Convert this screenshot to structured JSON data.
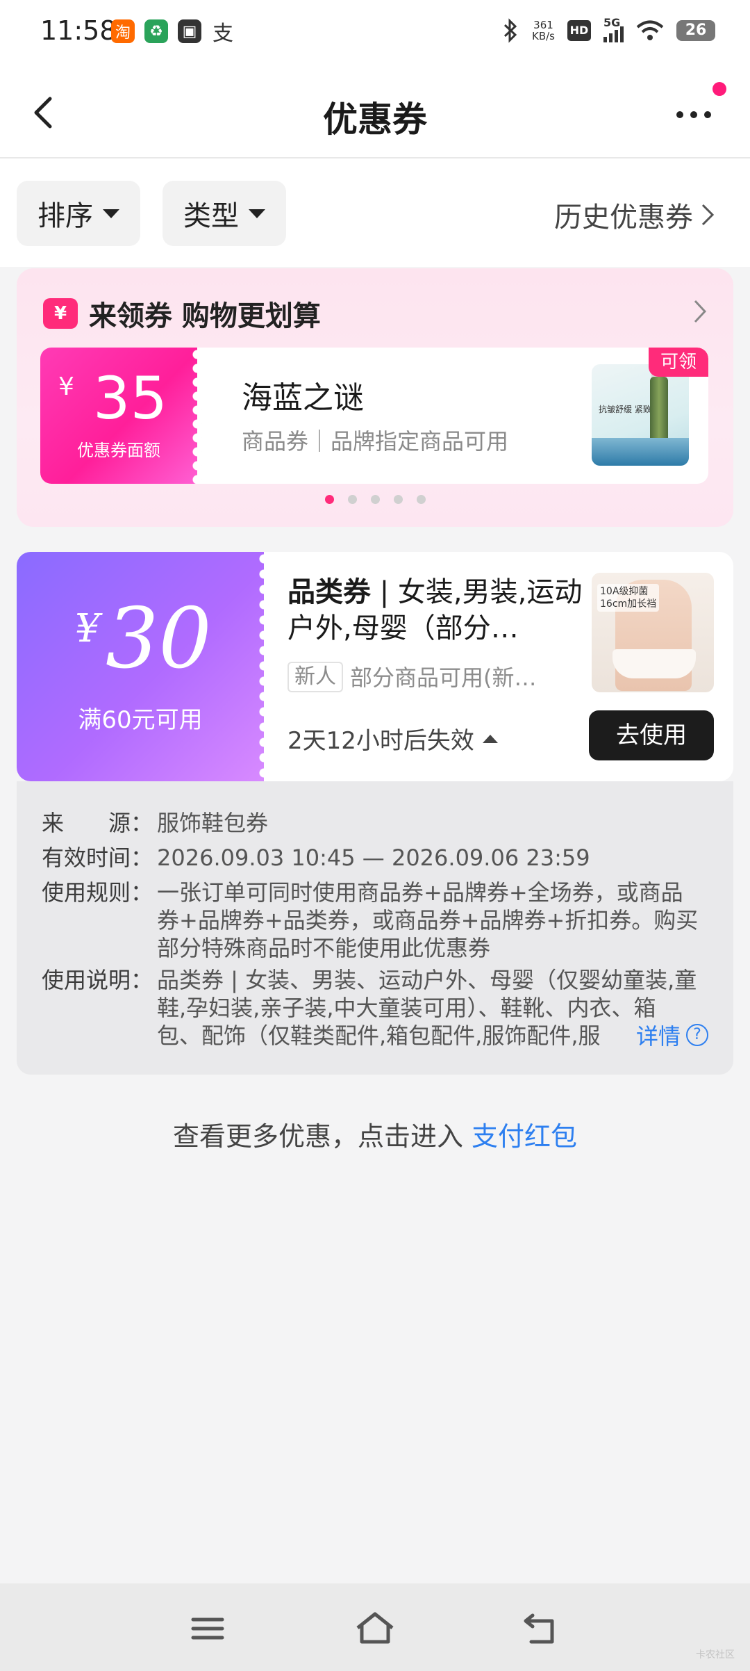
{
  "status_bar": {
    "time": "11:58",
    "app_icons": [
      {
        "name": "taobao-icon",
        "glyph": "淘",
        "color": "#ff6a00"
      },
      {
        "name": "leaf-app-icon",
        "glyph": "♻",
        "color": "#2aa35a"
      },
      {
        "name": "bus-card-icon",
        "glyph": "▣",
        "color": "#333333"
      },
      {
        "name": "alipay-icon",
        "glyph": "支",
        "color": "#333333"
      }
    ],
    "net_speed_value": "361",
    "net_speed_unit": "KB/s",
    "hd_label": "HD",
    "signal_label": "5G",
    "battery": "26"
  },
  "nav": {
    "title": "优惠券"
  },
  "filters": {
    "sort_label": "排序",
    "type_label": "类型",
    "history_label": "历史优惠券"
  },
  "promo": {
    "badge": "¥",
    "title": "来领券 购物更划算",
    "coupon": {
      "currency": "¥",
      "amount": "35",
      "amount_caption": "优惠券面额",
      "brand": "海蓝之谜",
      "description": "商品券｜品牌指定商品可用",
      "tag": "可领",
      "image_text": "抗皱舒缓 紧致保湿"
    },
    "carousel_pages": 5,
    "carousel_active": 0
  },
  "coupon": {
    "currency": "¥",
    "amount": "30",
    "condition": "满60元可用",
    "title_strong": "品类券",
    "title_rest": " | 女装,男装,运动户外,母婴（部分…",
    "new_tag": "新人",
    "scope": "部分商品可用(新…",
    "expiry": "2天12小时后失效",
    "use_button": "去使用",
    "image_text_1": "10A级抑菌",
    "image_text_2": "16cm加长裆"
  },
  "details": {
    "source_key": "来　　源：",
    "source_val": "服饰鞋包券",
    "valid_key": "有效时间：",
    "valid_val": "2026.09.03 10:45 — 2026.09.06 23:59",
    "rule_key": "使用规则：",
    "rule_val": "一张订单可同时使用商品券+品牌券+全场券，或商品券+品牌券+品类券，或商品券+品牌券+折扣券。购买部分特殊商品时不能使用此优惠券",
    "note_key": "使用说明：",
    "note_val": "品类券 | 女装、男装、运动户外、母婴（仅婴幼童装,童鞋,孕妇装,亲子装,中大童装可用）、鞋靴、内衣、箱包、配饰（仅鞋类配件,箱包配件,服饰配件,服",
    "more_label": "详情",
    "more_icon": "?"
  },
  "footer": {
    "text": "查看更多优惠，点击进入 ",
    "link": "支付红包"
  },
  "watermark": "卡农社区",
  "colors": {
    "accent_pink": "#ff2b7a",
    "link_blue": "#2d7ff0",
    "coupon_purple": "#9a6bff"
  }
}
